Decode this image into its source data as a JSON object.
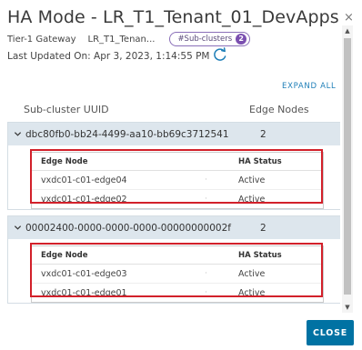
{
  "dialog": {
    "title": "HA Mode - LR_T1_Tenant_01_DevApps",
    "close_glyph": "×",
    "gateway_label": "Tier-1 Gateway",
    "gateway_name": "LR_T1_Tenan...",
    "subclusters_pill": "#Sub-clusters",
    "subclusters_count": "2",
    "last_updated": "Last Updated On: Apr 3, 2023, 1:14:55 PM",
    "expand_all": "EXPAND ALL",
    "col_subcluster": "Sub-cluster UUID",
    "col_edge_nodes": "Edge Nodes",
    "close_button": "CLOSE"
  },
  "subclusters": [
    {
      "uuid": "dbc80fb0-bb24-4499-aa10-bb69c3712541",
      "edge_count": "2",
      "head_node": "Edge Node",
      "head_status": "HA Status",
      "rows": [
        {
          "node": "vxdc01-c01-edge04",
          "sep": "·",
          "status": "Active"
        },
        {
          "node": "vxdc01-c01-edge02",
          "sep": "·",
          "status": "Active"
        }
      ]
    },
    {
      "uuid": "00002400-0000-0000-0000-00000000002f",
      "edge_count": "2",
      "head_node": "Edge Node",
      "head_status": "HA Status",
      "rows": [
        {
          "node": "vxdc01-c01-edge03",
          "sep": "·",
          "status": "Active"
        },
        {
          "node": "vxdc01-c01-edge01",
          "sep": "·",
          "status": "Active"
        }
      ]
    }
  ],
  "colors": {
    "accent": "#0072a3",
    "group_header": "#dde6ed",
    "highlight": "#d2202a",
    "pill_border": "#8a6fb8"
  },
  "icons": [
    "close-icon",
    "refresh-icon",
    "chevron-down-icon",
    "scroll-up-icon",
    "scroll-down-icon"
  ]
}
